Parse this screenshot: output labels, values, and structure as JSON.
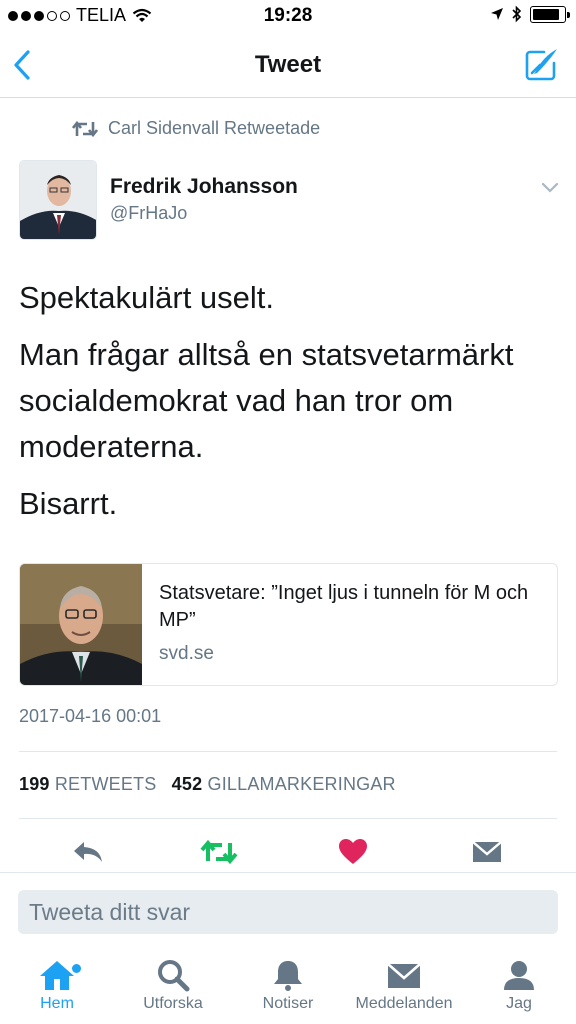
{
  "status_bar": {
    "carrier": "TELIA",
    "time": "19:28",
    "signal_bars_filled": 3,
    "signal_bars_total": 5,
    "battery_level": 0.85
  },
  "nav": {
    "title": "Tweet",
    "back_icon": "chevron-left-icon",
    "compose_icon": "compose-icon"
  },
  "retweet": {
    "text": "Carl Sidenvall Retweetade"
  },
  "author": {
    "name": "Fredrik Johansson",
    "handle": "@FrHaJo"
  },
  "tweet": {
    "paragraphs": [
      "Spektakulärt uselt.",
      "Man frågar alltså en statsvetarmärkt socialdemokrat vad han tror om moderaterna.",
      "Bisarrt."
    ],
    "timestamp": "2017-04-16 00:01"
  },
  "card": {
    "title": "Statsvetare: ”Inget ljus i tunneln för M och MP”",
    "domain": "svd.se"
  },
  "stats": {
    "retweets_count": "199",
    "retweets_label": "RETWEETS",
    "likes_count": "452",
    "likes_label": "GILLAMARKERINGAR"
  },
  "actions": {
    "reply_icon": "reply-icon",
    "retweet_icon": "retweet-icon",
    "like_icon": "heart-icon",
    "dm_icon": "envelope-icon"
  },
  "reply": {
    "placeholder": "Tweeta ditt svar"
  },
  "tabs": [
    {
      "label": "Hem",
      "icon": "home-icon",
      "active": true
    },
    {
      "label": "Utforska",
      "icon": "search-icon",
      "active": false
    },
    {
      "label": "Notiser",
      "icon": "bell-icon",
      "active": false
    },
    {
      "label": "Meddelanden",
      "icon": "envelope-icon",
      "active": false
    },
    {
      "label": "Jag",
      "icon": "person-icon",
      "active": false
    }
  ],
  "colors": {
    "accent": "#1da1f2",
    "retweet_green": "#17bf63",
    "like_red": "#e0245e",
    "muted": "#657786"
  }
}
